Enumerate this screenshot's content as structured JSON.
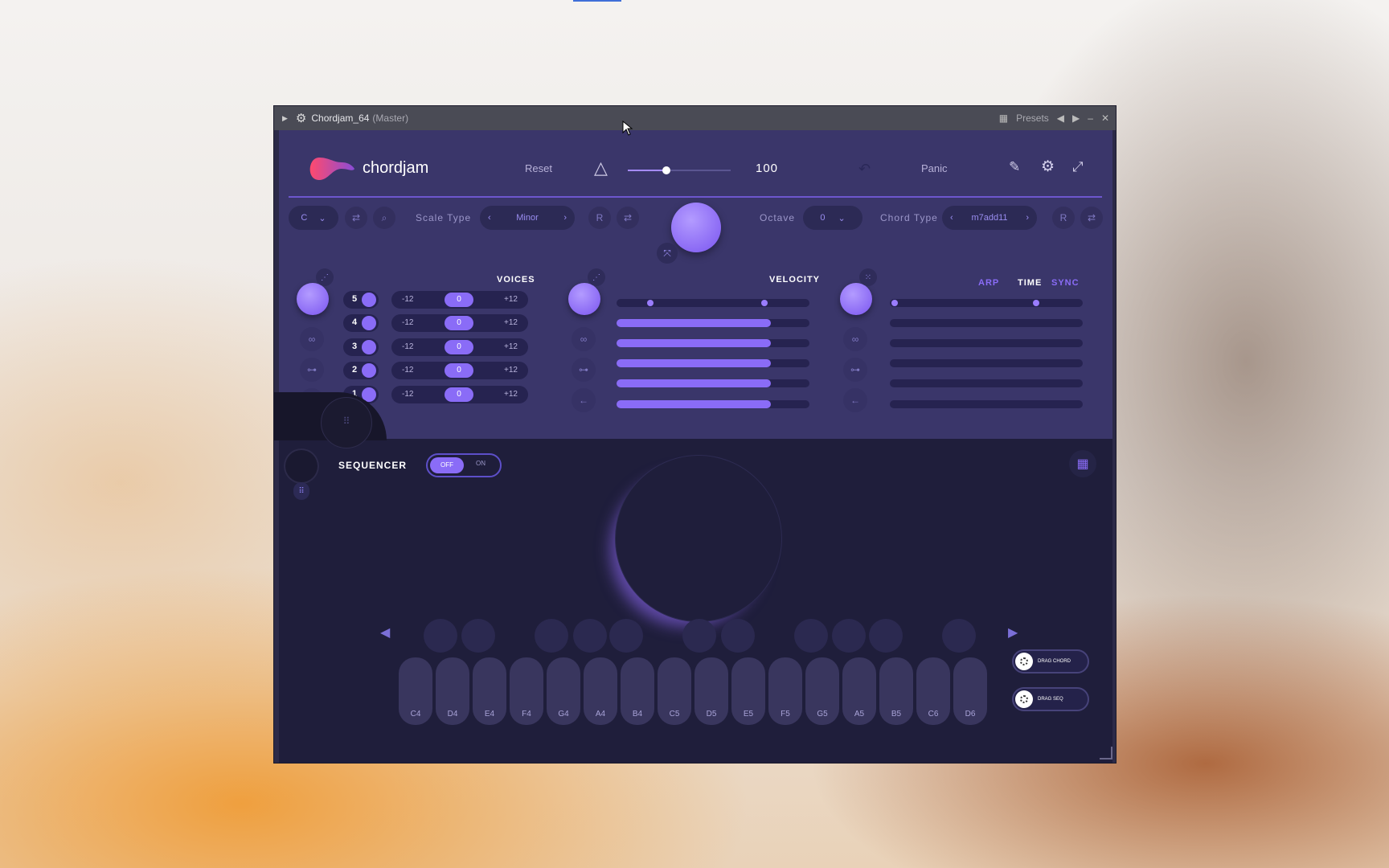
{
  "titlebar": {
    "plugin_name": "Chordjam_64",
    "context": "(Master)",
    "presets_label": "Presets"
  },
  "header": {
    "brand": "chordjam",
    "reset": "Reset",
    "tempo": "100",
    "panic": "Panic"
  },
  "controls": {
    "key": "C",
    "scale_type_label": "Scale Type",
    "scale_value": "Minor",
    "r_label": "R",
    "octave_label": "Octave",
    "octave_value": "0",
    "chord_type_label": "Chord Type",
    "chord_value": "m7add11",
    "r2_label": "R"
  },
  "voices": {
    "title": "VOICES",
    "rows": [
      {
        "num": "5",
        "lo": "-12",
        "mid": "0",
        "hi": "+12"
      },
      {
        "num": "4",
        "lo": "-12",
        "mid": "0",
        "hi": "+12"
      },
      {
        "num": "3",
        "lo": "-12",
        "mid": "0",
        "hi": "+12"
      },
      {
        "num": "2",
        "lo": "-12",
        "mid": "0",
        "hi": "+12"
      },
      {
        "num": "1",
        "lo": "-12",
        "mid": "0",
        "hi": "+12"
      }
    ]
  },
  "velocity": {
    "title": "VELOCITY",
    "levels": [
      0.8,
      0.8,
      0.8,
      0.8,
      0.8
    ]
  },
  "timing": {
    "arp": "ARP",
    "time": "TIME",
    "sync": "SYNC"
  },
  "sequencer": {
    "label": "SEQUENCER",
    "off": "OFF",
    "on": "ON"
  },
  "keys": [
    "C4",
    "D4",
    "E4",
    "F4",
    "G4",
    "A4",
    "B4",
    "C5",
    "D5",
    "E5",
    "F5",
    "G5",
    "A5",
    "B5",
    "C6",
    "D6"
  ],
  "drag": {
    "chord": "DRAG CHORD",
    "seq": "DRAG SEQ"
  },
  "colors": {
    "accent": "#8a6cf7",
    "panel": "#3a366a",
    "dark": "#1f1e3b"
  }
}
